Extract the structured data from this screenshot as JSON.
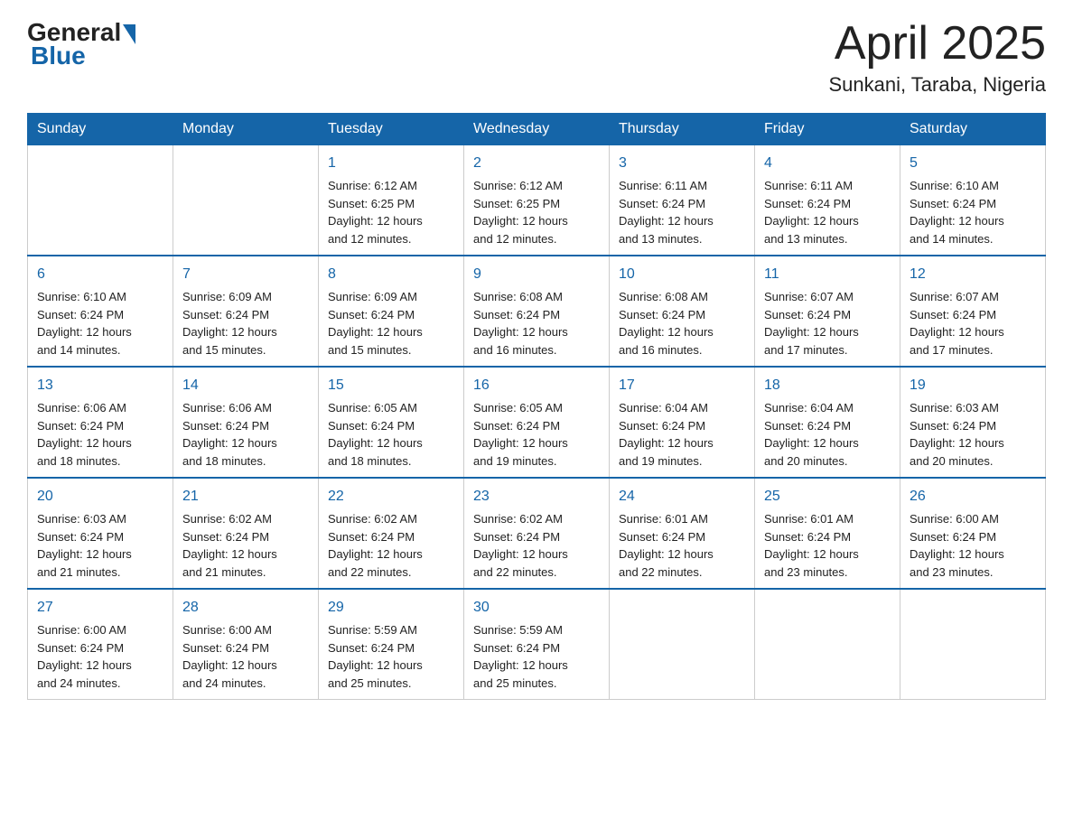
{
  "header": {
    "logo_text": "General",
    "logo_blue": "Blue",
    "month_title": "April 2025",
    "location": "Sunkani, Taraba, Nigeria"
  },
  "weekdays": [
    "Sunday",
    "Monday",
    "Tuesday",
    "Wednesday",
    "Thursday",
    "Friday",
    "Saturday"
  ],
  "weeks": [
    [
      {
        "day": "",
        "info": ""
      },
      {
        "day": "",
        "info": ""
      },
      {
        "day": "1",
        "info": "Sunrise: 6:12 AM\nSunset: 6:25 PM\nDaylight: 12 hours\nand 12 minutes."
      },
      {
        "day": "2",
        "info": "Sunrise: 6:12 AM\nSunset: 6:25 PM\nDaylight: 12 hours\nand 12 minutes."
      },
      {
        "day": "3",
        "info": "Sunrise: 6:11 AM\nSunset: 6:24 PM\nDaylight: 12 hours\nand 13 minutes."
      },
      {
        "day": "4",
        "info": "Sunrise: 6:11 AM\nSunset: 6:24 PM\nDaylight: 12 hours\nand 13 minutes."
      },
      {
        "day": "5",
        "info": "Sunrise: 6:10 AM\nSunset: 6:24 PM\nDaylight: 12 hours\nand 14 minutes."
      }
    ],
    [
      {
        "day": "6",
        "info": "Sunrise: 6:10 AM\nSunset: 6:24 PM\nDaylight: 12 hours\nand 14 minutes."
      },
      {
        "day": "7",
        "info": "Sunrise: 6:09 AM\nSunset: 6:24 PM\nDaylight: 12 hours\nand 15 minutes."
      },
      {
        "day": "8",
        "info": "Sunrise: 6:09 AM\nSunset: 6:24 PM\nDaylight: 12 hours\nand 15 minutes."
      },
      {
        "day": "9",
        "info": "Sunrise: 6:08 AM\nSunset: 6:24 PM\nDaylight: 12 hours\nand 16 minutes."
      },
      {
        "day": "10",
        "info": "Sunrise: 6:08 AM\nSunset: 6:24 PM\nDaylight: 12 hours\nand 16 minutes."
      },
      {
        "day": "11",
        "info": "Sunrise: 6:07 AM\nSunset: 6:24 PM\nDaylight: 12 hours\nand 17 minutes."
      },
      {
        "day": "12",
        "info": "Sunrise: 6:07 AM\nSunset: 6:24 PM\nDaylight: 12 hours\nand 17 minutes."
      }
    ],
    [
      {
        "day": "13",
        "info": "Sunrise: 6:06 AM\nSunset: 6:24 PM\nDaylight: 12 hours\nand 18 minutes."
      },
      {
        "day": "14",
        "info": "Sunrise: 6:06 AM\nSunset: 6:24 PM\nDaylight: 12 hours\nand 18 minutes."
      },
      {
        "day": "15",
        "info": "Sunrise: 6:05 AM\nSunset: 6:24 PM\nDaylight: 12 hours\nand 18 minutes."
      },
      {
        "day": "16",
        "info": "Sunrise: 6:05 AM\nSunset: 6:24 PM\nDaylight: 12 hours\nand 19 minutes."
      },
      {
        "day": "17",
        "info": "Sunrise: 6:04 AM\nSunset: 6:24 PM\nDaylight: 12 hours\nand 19 minutes."
      },
      {
        "day": "18",
        "info": "Sunrise: 6:04 AM\nSunset: 6:24 PM\nDaylight: 12 hours\nand 20 minutes."
      },
      {
        "day": "19",
        "info": "Sunrise: 6:03 AM\nSunset: 6:24 PM\nDaylight: 12 hours\nand 20 minutes."
      }
    ],
    [
      {
        "day": "20",
        "info": "Sunrise: 6:03 AM\nSunset: 6:24 PM\nDaylight: 12 hours\nand 21 minutes."
      },
      {
        "day": "21",
        "info": "Sunrise: 6:02 AM\nSunset: 6:24 PM\nDaylight: 12 hours\nand 21 minutes."
      },
      {
        "day": "22",
        "info": "Sunrise: 6:02 AM\nSunset: 6:24 PM\nDaylight: 12 hours\nand 22 minutes."
      },
      {
        "day": "23",
        "info": "Sunrise: 6:02 AM\nSunset: 6:24 PM\nDaylight: 12 hours\nand 22 minutes."
      },
      {
        "day": "24",
        "info": "Sunrise: 6:01 AM\nSunset: 6:24 PM\nDaylight: 12 hours\nand 22 minutes."
      },
      {
        "day": "25",
        "info": "Sunrise: 6:01 AM\nSunset: 6:24 PM\nDaylight: 12 hours\nand 23 minutes."
      },
      {
        "day": "26",
        "info": "Sunrise: 6:00 AM\nSunset: 6:24 PM\nDaylight: 12 hours\nand 23 minutes."
      }
    ],
    [
      {
        "day": "27",
        "info": "Sunrise: 6:00 AM\nSunset: 6:24 PM\nDaylight: 12 hours\nand 24 minutes."
      },
      {
        "day": "28",
        "info": "Sunrise: 6:00 AM\nSunset: 6:24 PM\nDaylight: 12 hours\nand 24 minutes."
      },
      {
        "day": "29",
        "info": "Sunrise: 5:59 AM\nSunset: 6:24 PM\nDaylight: 12 hours\nand 25 minutes."
      },
      {
        "day": "30",
        "info": "Sunrise: 5:59 AM\nSunset: 6:24 PM\nDaylight: 12 hours\nand 25 minutes."
      },
      {
        "day": "",
        "info": ""
      },
      {
        "day": "",
        "info": ""
      },
      {
        "day": "",
        "info": ""
      }
    ]
  ]
}
